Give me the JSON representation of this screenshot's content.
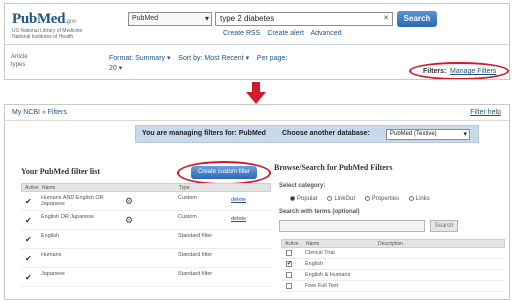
{
  "colors": {
    "highlight": "#d01c2b",
    "link": "#20558a",
    "button_blue": "#2c66b0",
    "banner_bg": "#c8d9ec"
  },
  "top": {
    "logo": {
      "part1": "Pub",
      "part2": "Med",
      "suffix": ".gov",
      "subtitle_line1": "US National Library of Medicine",
      "subtitle_line2": "National Institutes of Health"
    },
    "database_select": "PubMed",
    "search_query": "type 2 diabetes",
    "search_button": "Search",
    "links": [
      "Create RSS",
      "Create alert",
      "Advanced"
    ],
    "article_types": {
      "line1": "Article",
      "line2": "types"
    },
    "format": {
      "format_label": "Format:",
      "format_value": "Summary",
      "sort_label": "Sort by:",
      "sort_value": "Most Recent",
      "per_page_label": "Per page:",
      "per_page_value": "20"
    },
    "filters": {
      "label": "Filters:",
      "link": "Manage Filters"
    }
  },
  "bottom": {
    "breadcrumb": "My NCBI » Filters",
    "filter_help": "Filter help",
    "banner": {
      "text": "You are managing filters for: PubMed",
      "choose_label": "Choose another database:",
      "database": "PubMed (Textive)"
    },
    "filter_set_title": "Your PubMed filter list",
    "create_button": "Create custom filter",
    "table_headers": {
      "active": "Active",
      "name": "Name",
      "type": "Type"
    },
    "filters": [
      {
        "name": "Humans AND English OR Japanese",
        "type": "Custom",
        "action": "delete",
        "gear": true
      },
      {
        "name": "English OR Japanese",
        "type": "Custom",
        "action": "delete",
        "gear": true
      },
      {
        "name": "English",
        "type": "Standard filter",
        "action": "",
        "gear": false
      },
      {
        "name": "Humans",
        "type": "Standard filter",
        "action": "",
        "gear": false
      },
      {
        "name": "Japanese",
        "type": "Standard filter",
        "action": "",
        "gear": false
      }
    ],
    "browse_title": "Browse/Search for PubMed Filters",
    "select_category_label": "Select category:",
    "categories": [
      {
        "label": "Popular",
        "selected": true
      },
      {
        "label": "LinkOut",
        "selected": false
      },
      {
        "label": "Properties",
        "selected": false
      },
      {
        "label": "Links",
        "selected": false
      }
    ],
    "search_terms_label": "Search with terms (optional)",
    "search_button": "Search",
    "browse_headers": {
      "active": "Active",
      "name": "Name",
      "description": "Description"
    },
    "browse_rows": [
      {
        "name": "Clinical Trial",
        "checked": false
      },
      {
        "name": "English",
        "checked": true
      },
      {
        "name": "English & Humans",
        "checked": false
      },
      {
        "name": "Free Full Text",
        "checked": false
      }
    ]
  }
}
